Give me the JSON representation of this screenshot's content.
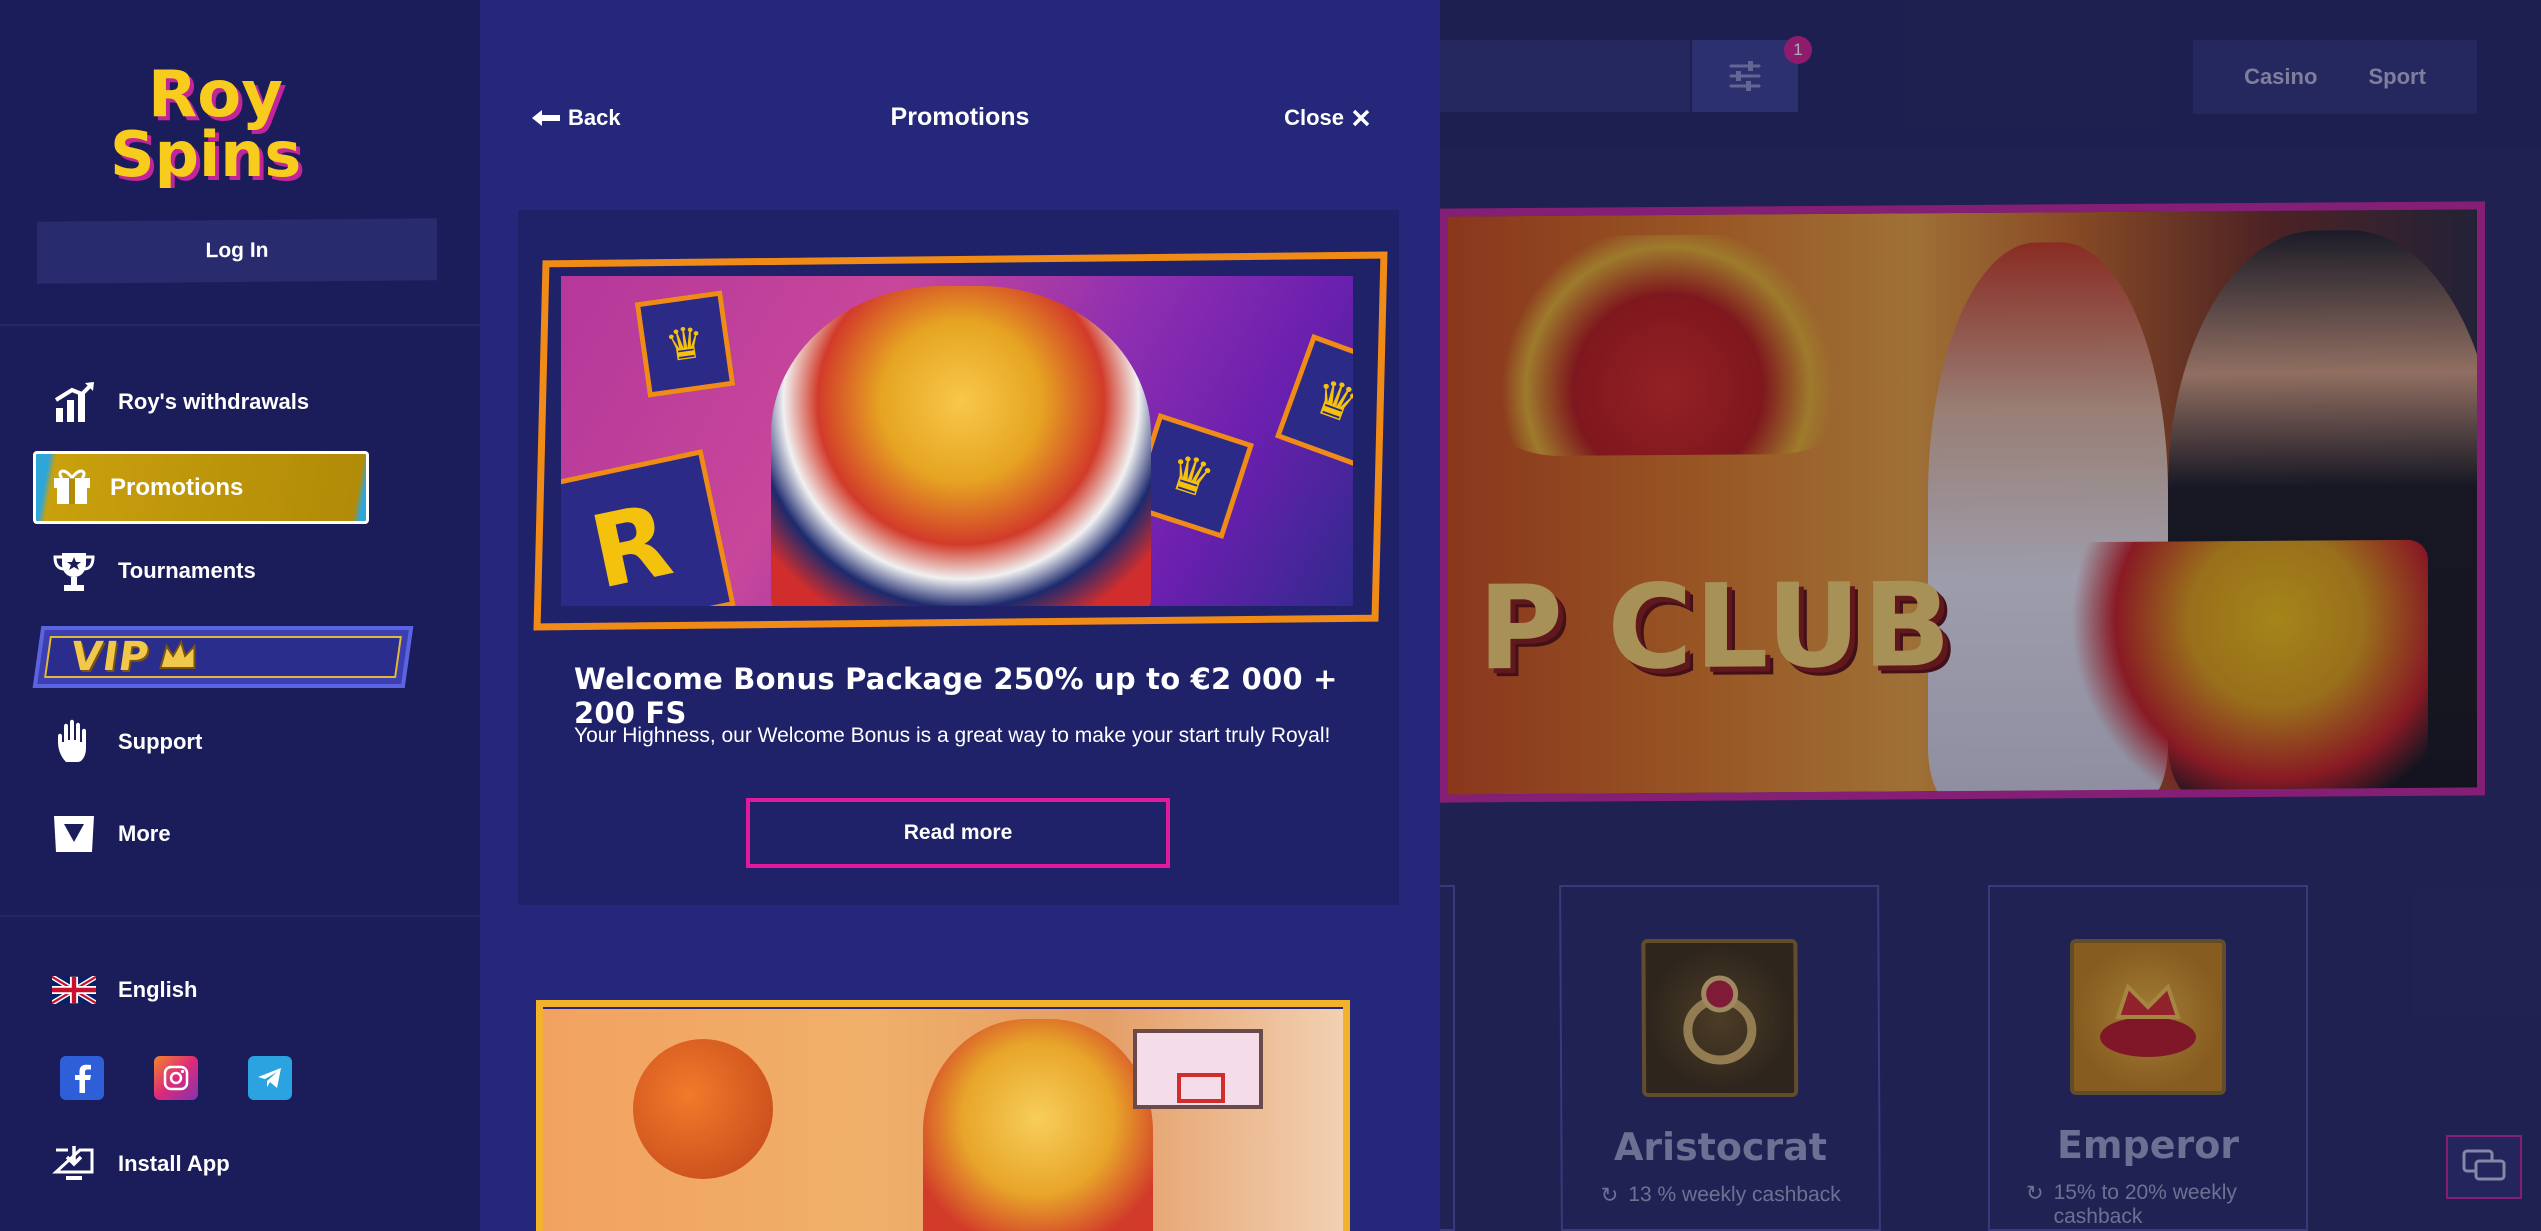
{
  "brand": {
    "logo_alt": "Roy Spins",
    "logo_line1": "Roy",
    "logo_line2": "Spins",
    "colors": {
      "sidebar_bg": "#1b1c5a",
      "panel_bg": "#24277a",
      "accent_pink": "#e01a9a",
      "accent_gold": "#c9a00d"
    }
  },
  "sidebar": {
    "login_label": "Log In",
    "nav": [
      {
        "label": "Roy's withdrawals",
        "icon": "chart-up-icon"
      },
      {
        "label": "Promotions",
        "icon": "gift-icon",
        "active": true
      },
      {
        "label": "Tournaments",
        "icon": "trophy-icon"
      },
      {
        "label": "Support",
        "icon": "hand-icon"
      },
      {
        "label": "More",
        "icon": "dropdown-triangle-icon"
      }
    ],
    "vip_label": "VIP",
    "language": {
      "label": "English",
      "icon": "uk-flag-icon"
    },
    "socials": [
      "facebook-icon",
      "instagram-icon",
      "telegram-icon"
    ],
    "install_label": "Install App"
  },
  "panel": {
    "back_label": "Back",
    "title": "Promotions",
    "close_label": "Close",
    "promos": [
      {
        "title": "Welcome Bonus Package 250% up to €2 000 + 200 FS",
        "description": "Your Highness, our Welcome Bonus is a great way to make your start truly Royal!",
        "cta": "Read more"
      }
    ]
  },
  "page": {
    "filter_badge": "1",
    "modes": [
      "Casino",
      "Sport"
    ],
    "hero_text": "P CLUB",
    "vip_levels": [
      {
        "name": "Aristocrat",
        "cashback": "13 % weekly cashback",
        "icon": "ring-icon"
      },
      {
        "name": "Emperor",
        "cashback": "15% to 20% weekly cashback",
        "icon": "crown-pillow-icon"
      }
    ]
  }
}
